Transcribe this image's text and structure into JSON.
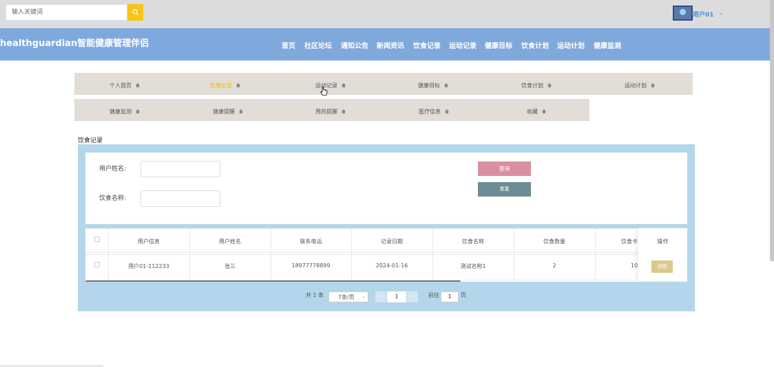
{
  "header": {
    "search_placeholder": "输入关键词",
    "search_icon": "search-icon",
    "user_name": "用户01",
    "user_caret": "⌄"
  },
  "navbar": {
    "brand": "healthguardian智能健康管理伴侣",
    "items": [
      "首页",
      "社区论坛",
      "通知公告",
      "新闻资讯",
      "饮食记录",
      "运动记录",
      "健康目标",
      "饮食计划",
      "运动计划",
      "健康监测"
    ]
  },
  "tabs": {
    "row1": [
      "个人首页",
      "饮食记录",
      "运动记录",
      "健康目标",
      "饮食计划",
      "运动计划"
    ],
    "row2": [
      "健康监测",
      "健康提醒",
      "用药提醒",
      "医疗信息",
      "收藏"
    ],
    "active": "饮食记录"
  },
  "page_title": "饮食记录",
  "form": {
    "user_name_label": "用户姓名:",
    "food_name_label": "饮食名称:",
    "query_button": "查询",
    "reset_button": "重置"
  },
  "table": {
    "headers": [
      "用户信息",
      "用户姓名",
      "联系电话",
      "记录日期",
      "饮食名称",
      "饮食数量",
      "饮食卡",
      "操作"
    ],
    "rows": [
      {
        "user_info": "用户01-112233",
        "user_name": "张三",
        "phone": "18977778899",
        "date": "2024-01-16",
        "food_name": "测试名称1",
        "quantity": "2",
        "calories": "10",
        "action": "详情"
      }
    ]
  },
  "pagination": {
    "total": "共 1 条",
    "page_size": "7条/页",
    "prev": "‹",
    "current": "1",
    "next": "›",
    "goto_label": "前往",
    "goto_value": "1",
    "page_suffix": "页"
  }
}
